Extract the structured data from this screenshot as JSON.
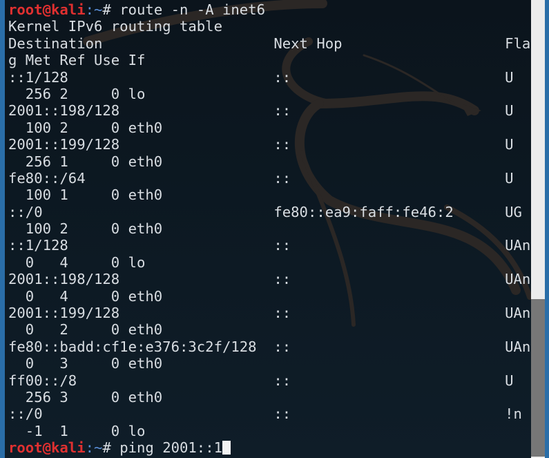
{
  "terminal": {
    "prompt_user": "root@kali",
    "prompt_path": ":~",
    "prompt_symbol": "# ",
    "command": "route -n -A inet6",
    "output_lines": [
      "Kernel IPv6 routing table",
      "Destination                    Next Hop                   Fla",
      "g Met Ref Use If",
      "::1/128                        ::                         U",
      "  256 2     0 lo",
      "2001::198/128                  ::                         U",
      "  100 2     0 eth0",
      "2001::199/128                  ::                         U",
      "  256 1     0 eth0",
      "fe80::/64                      ::                         U",
      "  100 1     0 eth0",
      "::/0                           fe80::ea9:faff:fe46:2      UG",
      "  100 2     0 eth0",
      "::1/128                        ::                         UAn",
      "  0   4     0 lo",
      "2001::198/128                  ::                         UAn",
      "  0   4     0 eth0",
      "2001::199/128                  ::                         UAn",
      "  0   2     0 eth0",
      "fe80::badd:cf1e:e376:3c2f/128  ::                         UAn",
      "  0   3     0 eth0",
      "ff00::/8                       ::                         U",
      "  256 3     0 eth0",
      "::/0                           ::                         !n",
      "  -1  1     0 lo"
    ],
    "next_command": "ping 2001::1"
  },
  "scrollbar": {
    "position_fraction": 0.66,
    "visible_fraction": 0.34
  }
}
